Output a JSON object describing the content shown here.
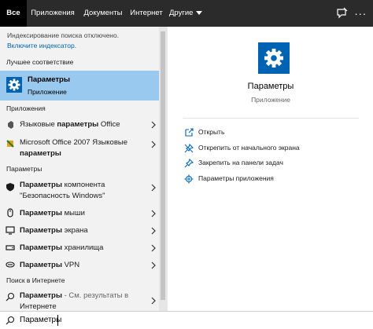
{
  "tabs": [
    {
      "label": "Все"
    },
    {
      "label": "Приложения"
    },
    {
      "label": "Документы"
    },
    {
      "label": "Интернет"
    },
    {
      "label": "Другие"
    }
  ],
  "notice": {
    "text": "Индексирование поиска отключено.",
    "link": "Включите индексатор."
  },
  "sections": {
    "best_match": "Лучшее соответствие",
    "apps": "Приложения",
    "settings": "Параметры",
    "web": "Поиск в Интернете"
  },
  "best_match": {
    "title": "Параметры",
    "subtitle": "Приложение",
    "icon": "gear-icon"
  },
  "apps": [
    {
      "pre": "Языковые ",
      "bold": "параметры",
      "post": " Office",
      "icon": "office-language-icon"
    },
    {
      "line1": "Microsoft Office 2007 Языковые",
      "line2_bold": "параметры",
      "icon": "office-2007-icon"
    }
  ],
  "settings": [
    {
      "line1_bold": "Параметры",
      "line1_rest": " компонента",
      "line2": "\"Безопасность Windows\"",
      "icon": "shield-icon"
    },
    {
      "bold": "Параметры",
      "rest": " мыши",
      "icon": "mouse-icon"
    },
    {
      "bold": "Параметры",
      "rest": " экрана",
      "icon": "display-icon"
    },
    {
      "bold": "Параметры",
      "rest": " хранилища",
      "icon": "storage-icon"
    },
    {
      "bold": "Параметры",
      "rest": " VPN",
      "icon": "vpn-icon"
    }
  ],
  "web": {
    "bold": "Параметры",
    "rest": " - См. результаты в",
    "line2": "Интернете",
    "icon": "search-icon"
  },
  "preview": {
    "title": "Параметры",
    "subtitle": "Приложение",
    "icon": "gear-icon"
  },
  "actions": [
    {
      "label": "Открыть",
      "icon": "open-icon"
    },
    {
      "label": "Открепить от начального экрана",
      "icon": "unpin-icon"
    },
    {
      "label": "Закрепить на панели задач",
      "icon": "pin-icon"
    },
    {
      "label": "Параметры приложения",
      "icon": "gear-icon"
    }
  ],
  "search": {
    "value": "Параметры"
  },
  "colors": {
    "accent": "#0063b1",
    "selection": "#99c9ef",
    "topbar": "#2b2b2b"
  }
}
